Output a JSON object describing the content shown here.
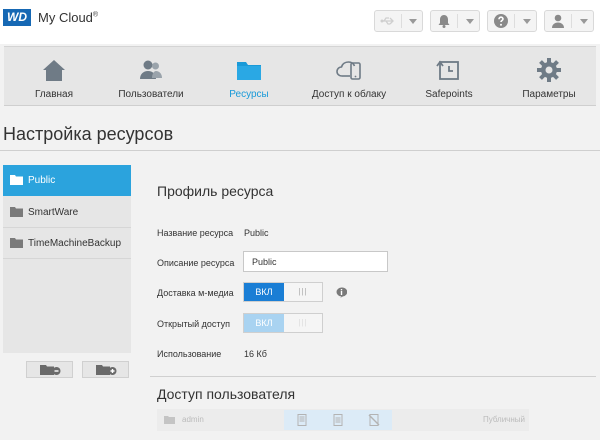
{
  "app": {
    "logo": "WD",
    "title": "My Cloud",
    "trademark": "®"
  },
  "header_buttons": [
    {
      "name": "usb-icon"
    },
    {
      "name": "bell-icon"
    },
    {
      "name": "help-icon"
    },
    {
      "name": "user-icon"
    }
  ],
  "nav": {
    "items": [
      {
        "label": "Главная",
        "icon": "home-icon",
        "active": false
      },
      {
        "label": "Пользователи",
        "icon": "users-icon",
        "active": false
      },
      {
        "label": "Ресурсы",
        "icon": "folder-icon",
        "active": true
      },
      {
        "label": "Доступ к облаку",
        "icon": "cloud-device-icon",
        "active": false
      },
      {
        "label": "Safepoints",
        "icon": "safepoint-icon",
        "active": false
      },
      {
        "label": "Параметры",
        "icon": "gear-icon",
        "active": false
      }
    ]
  },
  "page": {
    "title": "Настройка ресурсов"
  },
  "shares": {
    "items": [
      {
        "label": "Public",
        "selected": true
      },
      {
        "label": "SmartWare",
        "selected": false
      },
      {
        "label": "TimeMachineBackup",
        "selected": false
      }
    ],
    "remove_button_icon": "folder-remove-icon",
    "add_button_icon": "folder-add-icon"
  },
  "profile": {
    "title": "Профиль ресурса",
    "name_label": "Название ресурса",
    "name_value": "Public",
    "description_label": "Описание ресурса",
    "description_value": "Public",
    "media_label": "Доставка м-медиа",
    "media_toggle_on": "ВКЛ",
    "media_toggle_off": "|||",
    "public_label": "Открытый доступ",
    "public_toggle_on": "ВКЛ",
    "public_toggle_off": "|||",
    "usage_label": "Использование",
    "usage_value": "16 Кб"
  },
  "user_access": {
    "title": "Доступ пользователя",
    "rows": [
      {
        "user": "admin",
        "status": "Публичный"
      }
    ]
  },
  "colors": {
    "accent": "#2ba3dd",
    "toggle_on": "#1a7ed5",
    "logo": "#1668b4"
  }
}
